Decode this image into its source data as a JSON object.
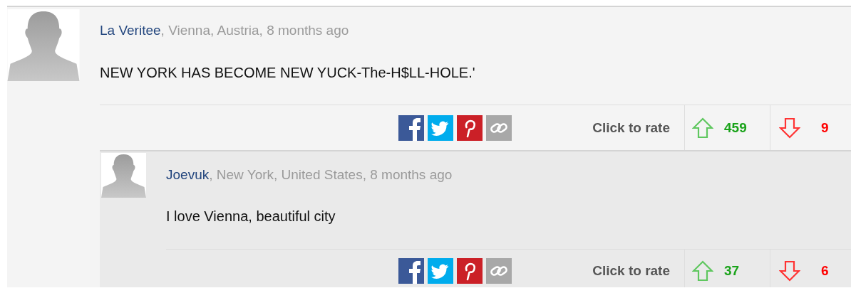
{
  "comments": [
    {
      "author": "La Veritee",
      "meta": ", Vienna, Austria, 8 months ago",
      "body": "NEW YORK HAS BECOME NEW YUCK-The-H$LL-HOLE.'",
      "rate_label": "Click to rate",
      "up_count": "459",
      "down_count": "9",
      "replies": [
        {
          "author": "Joevuk",
          "meta": ", New York, United States, 8 months ago",
          "body": "I love Vienna, beautiful city",
          "rate_label": "Click to rate",
          "up_count": "37",
          "down_count": "6"
        }
      ]
    }
  ]
}
